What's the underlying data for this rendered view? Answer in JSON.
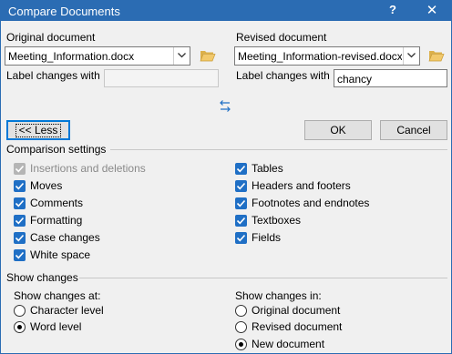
{
  "window": {
    "title": "Compare Documents",
    "help": "?",
    "close": "✕"
  },
  "original": {
    "heading": "Original document",
    "file": "Meeting_Information.docx",
    "label_changes": "Label changes with",
    "label_value": ""
  },
  "revised": {
    "heading": "Revised document",
    "file": "Meeting_Information-revised.docx",
    "label_changes": "Label changes with",
    "label_value": "chancy"
  },
  "buttons": {
    "less": "<< Less",
    "ok": "OK",
    "cancel": "Cancel"
  },
  "comparison": {
    "heading": "Comparison settings",
    "left": [
      {
        "label": "Insertions and deletions",
        "checked": true,
        "disabled": true
      },
      {
        "label": "Moves",
        "checked": true
      },
      {
        "label": "Comments",
        "checked": true
      },
      {
        "label": "Formatting",
        "checked": true
      },
      {
        "label": "Case changes",
        "checked": true
      },
      {
        "label": "White space",
        "checked": true
      }
    ],
    "right": [
      {
        "label": "Tables",
        "checked": true
      },
      {
        "label": "Headers and footers",
        "checked": true
      },
      {
        "label": "Footnotes and endnotes",
        "checked": true
      },
      {
        "label": "Textboxes",
        "checked": true
      },
      {
        "label": "Fields",
        "checked": true
      }
    ]
  },
  "show_changes": {
    "heading": "Show changes",
    "at_label": "Show changes at:",
    "at_options": [
      {
        "label": "Character level",
        "selected": false
      },
      {
        "label": "Word level",
        "selected": true
      }
    ],
    "in_label": "Show changes in:",
    "in_options": [
      {
        "label": "Original document",
        "selected": false
      },
      {
        "label": "Revised document",
        "selected": false
      },
      {
        "label": "New document",
        "selected": true
      }
    ]
  },
  "colors": {
    "titlebar": "#2b6cb3",
    "checkbox": "#1f6fc5",
    "focus": "#0078d7"
  }
}
